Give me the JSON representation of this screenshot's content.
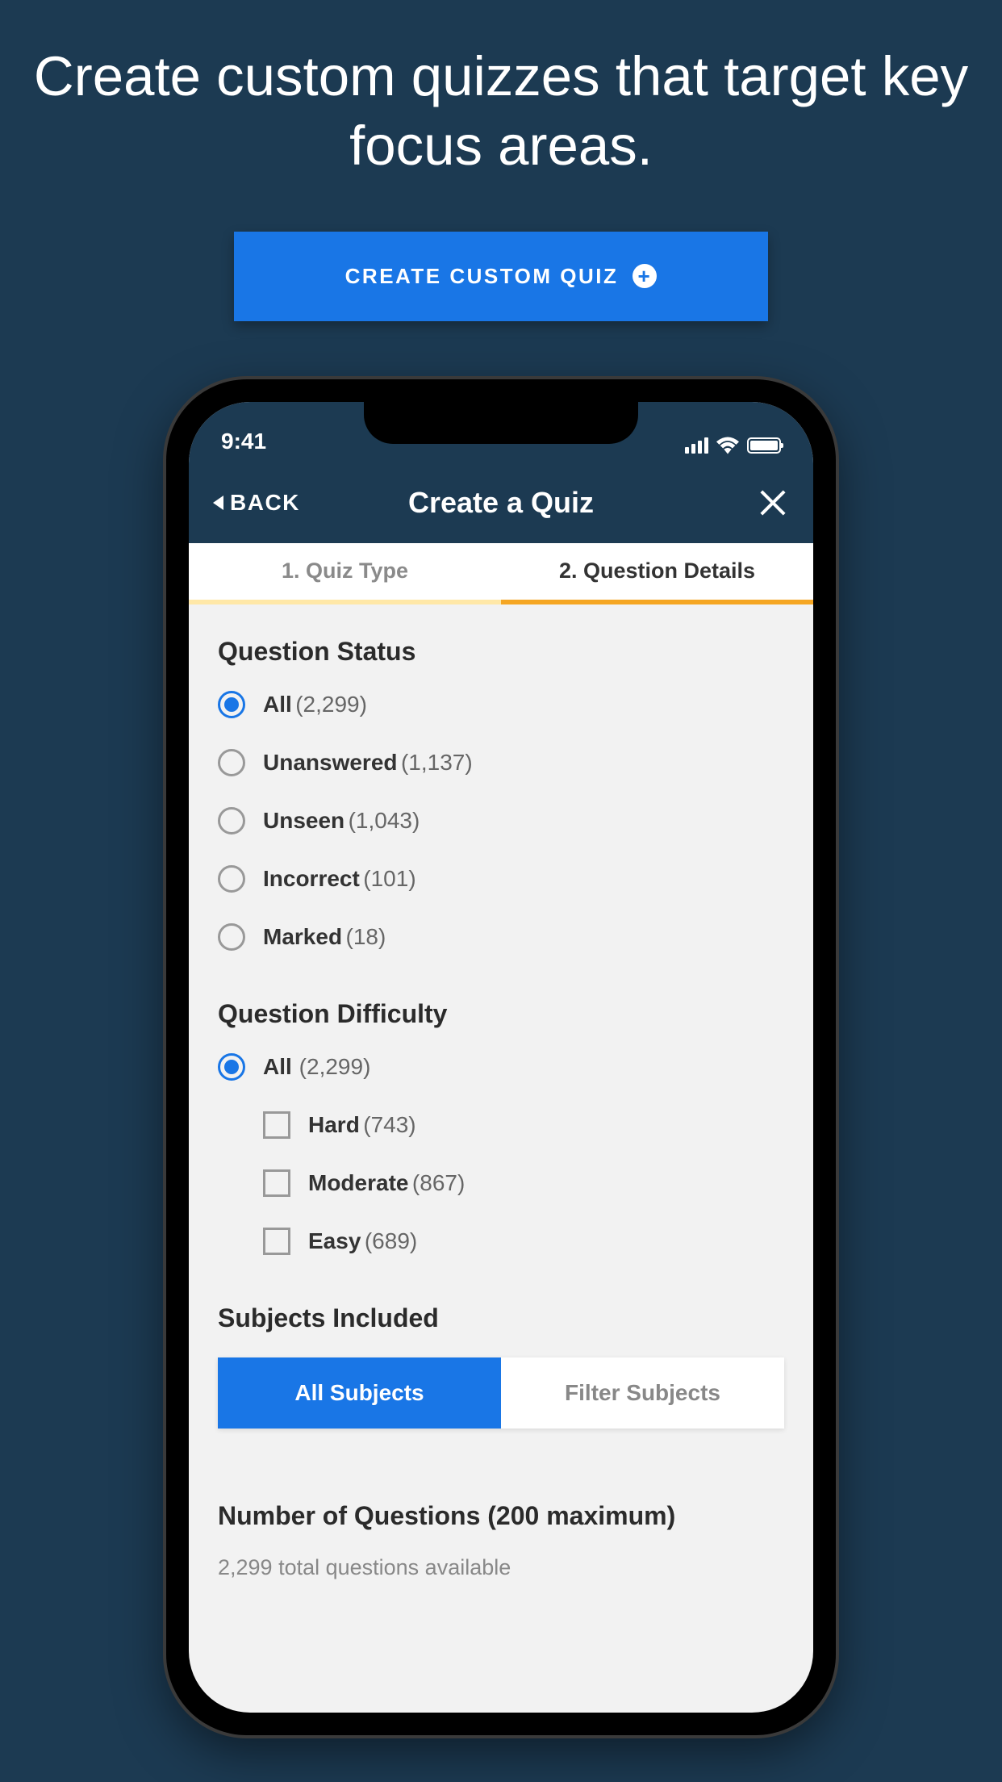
{
  "headline": "Create custom quizzes that target key focus areas.",
  "create_button_label": "CREATE CUSTOM QUIZ",
  "status": {
    "time": "9:41"
  },
  "nav": {
    "back_label": "BACK",
    "title": "Create a Quiz"
  },
  "tabs": {
    "tab1": "1. Quiz Type",
    "tab2": "2. Question Details"
  },
  "sections": {
    "status": {
      "title": "Question Status",
      "options": [
        {
          "label": "All",
          "count": "(2,299)"
        },
        {
          "label": "Unanswered",
          "count": "(1,137)"
        },
        {
          "label": "Unseen",
          "count": "(1,043)"
        },
        {
          "label": "Incorrect",
          "count": "(101)"
        },
        {
          "label": "Marked",
          "count": "(18)"
        }
      ]
    },
    "difficulty": {
      "title": "Question Difficulty",
      "all_label": "All",
      "all_count": "(2,299)",
      "options": [
        {
          "label": "Hard",
          "count": "(743)"
        },
        {
          "label": "Moderate",
          "count": "(867)"
        },
        {
          "label": "Easy",
          "count": "(689)"
        }
      ]
    },
    "subjects": {
      "title": "Subjects Included",
      "all_label": "All Subjects",
      "filter_label": "Filter Subjects"
    },
    "number": {
      "title": "Number of Questions (200 maximum)",
      "subtext": "2,299 total questions available"
    }
  }
}
